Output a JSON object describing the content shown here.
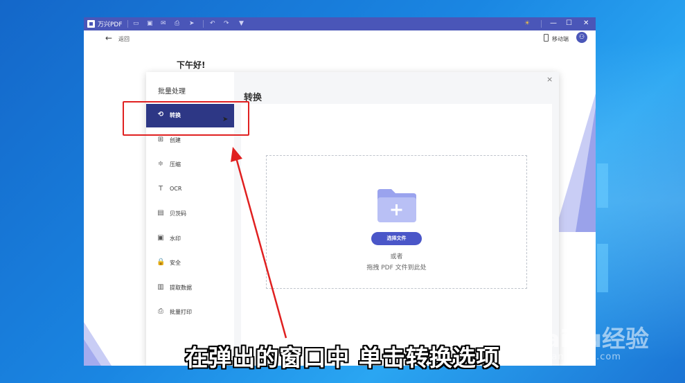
{
  "titlebar": {
    "app_name": "万兴PDF",
    "icons": [
      "folder-icon",
      "save-icon",
      "mail-icon",
      "print-icon",
      "share-icon",
      "undo-icon",
      "redo-icon",
      "dropdown-icon"
    ],
    "controls": {
      "minimize": "—",
      "maximize": "☐",
      "close": "✕"
    }
  },
  "topbar": {
    "back_label": "返回",
    "mobile_label": "移动端"
  },
  "home": {
    "greeting": "下午好!"
  },
  "modal": {
    "sidebar_title": "批量处理",
    "items": [
      {
        "label": "转换",
        "icon": "refresh-icon",
        "glyph": "⟲",
        "active": true
      },
      {
        "label": "创建",
        "icon": "create-icon",
        "glyph": "⊞"
      },
      {
        "label": "压缩",
        "icon": "compress-icon",
        "glyph": "≑"
      },
      {
        "label": "OCR",
        "icon": "ocr-icon",
        "glyph": "T"
      },
      {
        "label": "贝茨码",
        "icon": "bates-icon",
        "glyph": "▤"
      },
      {
        "label": "水印",
        "icon": "watermark-icon",
        "glyph": "▣"
      },
      {
        "label": "安全",
        "icon": "lock-icon",
        "glyph": "🔒"
      },
      {
        "label": "提取数据",
        "icon": "chart-icon",
        "glyph": "▥"
      },
      {
        "label": "批量打印",
        "icon": "print-icon",
        "glyph": "⎙"
      }
    ],
    "content_title": "转换",
    "select_button": "选择文件",
    "or_text": "或者",
    "drag_text": "拖拽 PDF 文件到此处",
    "close": "×"
  },
  "overlay": {
    "caption": "在弹出的窗口中 单击转换选项",
    "watermark_main": "Baidu经验",
    "watermark_sub": "jingyan.baidu.com",
    "highlight_color": "#e02020"
  },
  "colors": {
    "titlebar": "#4a56b8",
    "active_nav": "#2d3785",
    "accent_button": "#4a56c8"
  }
}
